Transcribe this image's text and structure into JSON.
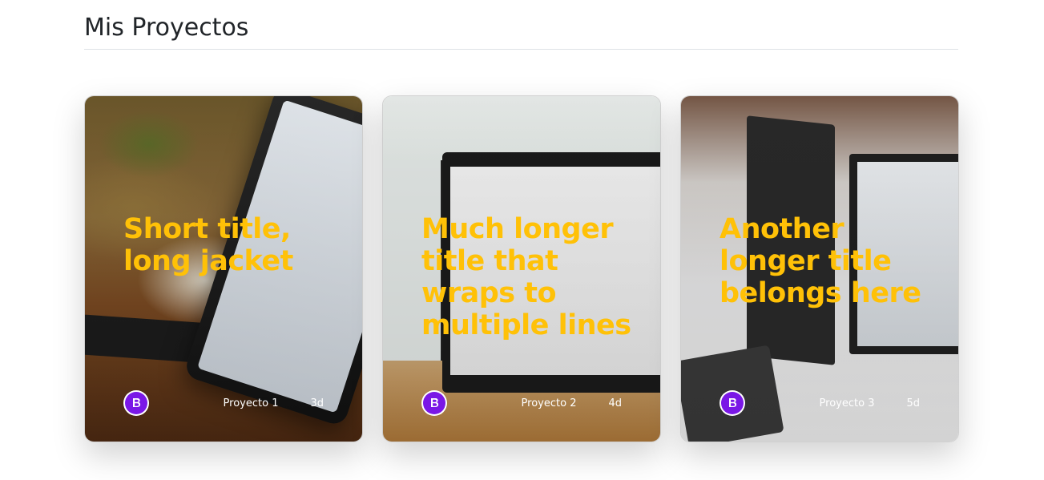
{
  "header": {
    "title": "Mis Proyectos"
  },
  "cards": [
    {
      "title": "Short title, long jacket",
      "label": "Proyecto 1",
      "time": "3d",
      "logo_icon": "bootstrap-icon"
    },
    {
      "title": "Much longer title that wraps to multiple lines",
      "label": "Proyecto 2",
      "time": "4d",
      "logo_icon": "bootstrap-icon"
    },
    {
      "title": "Another longer title belongs here",
      "label": "Proyecto 3",
      "time": "5d",
      "logo_icon": "bootstrap-icon"
    }
  ],
  "colors": {
    "title_accent": "#ffc107",
    "logo_purple": "#7a17e6",
    "heading_text": "#212529"
  }
}
